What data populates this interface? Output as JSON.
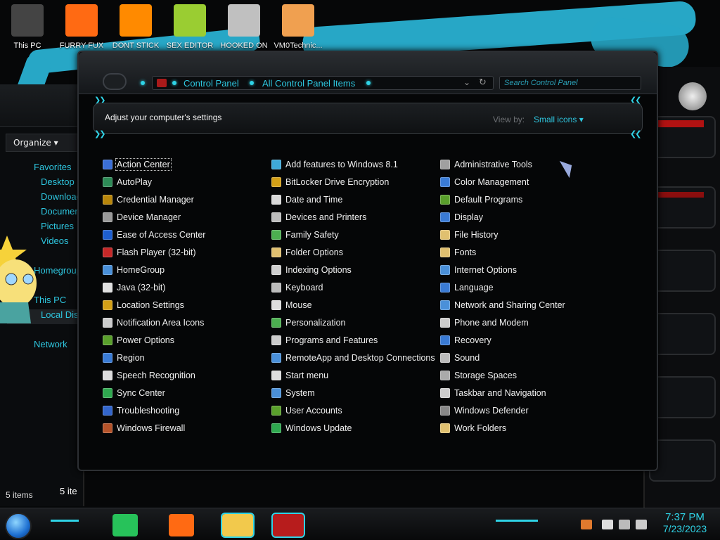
{
  "desktop": {
    "icons": [
      {
        "label": "This PC",
        "icon": "computer-icon",
        "color": "#444444"
      },
      {
        "label": "FURRY FUX",
        "icon": "firefox-icon",
        "color": "#ff6a13"
      },
      {
        "label": "DONT STICK",
        "icon": "vlc-cone-icon",
        "color": "#ff8a00"
      },
      {
        "label": "SEX EDITOR",
        "icon": "hxd-editor-icon",
        "color": "#9acd32"
      },
      {
        "label": "HOOKED ON",
        "icon": "game-icon",
        "color": "#c0c0c0"
      },
      {
        "label": "VM0Technic...",
        "icon": "doctor-avatar-icon",
        "color": "#f0a050"
      }
    ]
  },
  "background_window": {
    "organize": "Organize",
    "nav": [
      "Favorites",
      "Desktop",
      "Downloac",
      "Documen",
      "Pictures",
      "Videos",
      "",
      "Homegroup",
      "",
      "This PC",
      "Local Dis",
      "",
      "Network"
    ],
    "count": "5 ite",
    "status": "5 items"
  },
  "window": {
    "breadcrumb": [
      "Control Panel",
      "All Control Panel Items"
    ],
    "search_placeholder": "Search Control Panel",
    "header_title": "Adjust your computer's settings",
    "view_by_label": "View by:",
    "view_by_value": "Small icons"
  },
  "columns": [
    [
      {
        "label": "Action Center",
        "icon": "flag-icon",
        "color": "#3b6fd8",
        "focused": true
      },
      {
        "label": "AutoPlay",
        "icon": "autoplay-icon",
        "color": "#2e8b57"
      },
      {
        "label": "Credential Manager",
        "icon": "vault-icon",
        "color": "#b8860b"
      },
      {
        "label": "Device Manager",
        "icon": "printer-device-icon",
        "color": "#999999"
      },
      {
        "label": "Ease of Access Center",
        "icon": "accessibility-icon",
        "color": "#1e5fd0"
      },
      {
        "label": "Flash Player (32-bit)",
        "icon": "flash-icon",
        "color": "#c62828"
      },
      {
        "label": "HomeGroup",
        "icon": "homegroup-icon",
        "color": "#4a90d9"
      },
      {
        "label": "Java (32-bit)",
        "icon": "java-icon",
        "color": "#e0e0e0"
      },
      {
        "label": "Location Settings",
        "icon": "location-icon",
        "color": "#d4a017"
      },
      {
        "label": "Notification Area Icons",
        "icon": "notification-icon",
        "color": "#cccccc"
      },
      {
        "label": "Power Options",
        "icon": "power-icon",
        "color": "#5aa02c"
      },
      {
        "label": "Region",
        "icon": "globe-icon",
        "color": "#3a7bd5"
      },
      {
        "label": "Speech Recognition",
        "icon": "microphone-icon",
        "color": "#dddddd"
      },
      {
        "label": "Sync Center",
        "icon": "sync-icon",
        "color": "#2fa84f"
      },
      {
        "label": "Troubleshooting",
        "icon": "troubleshoot-icon",
        "color": "#3366cc"
      },
      {
        "label": "Windows Firewall",
        "icon": "firewall-icon",
        "color": "#b5532a"
      }
    ],
    [
      {
        "label": "Add features to Windows 8.1",
        "icon": "add-features-icon",
        "color": "#3fa9d8"
      },
      {
        "label": "BitLocker Drive Encryption",
        "icon": "bitlocker-icon",
        "color": "#d4a017"
      },
      {
        "label": "Date and Time",
        "icon": "calendar-clock-icon",
        "color": "#d9d9d9"
      },
      {
        "label": "Devices and Printers",
        "icon": "printer-icon",
        "color": "#bdbdbd"
      },
      {
        "label": "Family Safety",
        "icon": "family-icon",
        "color": "#4caf50"
      },
      {
        "label": "Folder Options",
        "icon": "folder-options-icon",
        "color": "#e0c070"
      },
      {
        "label": "Indexing Options",
        "icon": "indexing-icon",
        "color": "#cfcfcf"
      },
      {
        "label": "Keyboard",
        "icon": "keyboard-icon",
        "color": "#bbbbbb"
      },
      {
        "label": "Mouse",
        "icon": "mouse-icon",
        "color": "#dddddd"
      },
      {
        "label": "Personalization",
        "icon": "personalization-icon",
        "color": "#4caf50"
      },
      {
        "label": "Programs and Features",
        "icon": "programs-icon",
        "color": "#cccccc"
      },
      {
        "label": "RemoteApp and Desktop Connections",
        "icon": "remoteapp-icon",
        "color": "#4a90d9"
      },
      {
        "label": "Start menu",
        "icon": "start-menu-icon",
        "color": "#dddddd"
      },
      {
        "label": "System",
        "icon": "system-icon",
        "color": "#4a90d9"
      },
      {
        "label": "User Accounts",
        "icon": "user-accounts-icon",
        "color": "#5aa02c"
      },
      {
        "label": "Windows Update",
        "icon": "windows-update-icon",
        "color": "#2fa84f"
      }
    ],
    [
      {
        "label": "Administrative Tools",
        "icon": "admin-tools-icon",
        "color": "#a0a0a0"
      },
      {
        "label": "Color Management",
        "icon": "color-management-icon",
        "color": "#3a7bd5"
      },
      {
        "label": "Default Programs",
        "icon": "default-programs-icon",
        "color": "#5aa02c"
      },
      {
        "label": "Display",
        "icon": "display-icon",
        "color": "#3a7bd5"
      },
      {
        "label": "File History",
        "icon": "file-history-icon",
        "color": "#e0c070"
      },
      {
        "label": "Fonts",
        "icon": "fonts-icon",
        "color": "#e0c070"
      },
      {
        "label": "Internet Options",
        "icon": "internet-options-icon",
        "color": "#4a90d9"
      },
      {
        "label": "Language",
        "icon": "language-icon",
        "color": "#3a7bd5"
      },
      {
        "label": "Network and Sharing Center",
        "icon": "network-icon",
        "color": "#4a90d9"
      },
      {
        "label": "Phone and Modem",
        "icon": "phone-modem-icon",
        "color": "#cccccc"
      },
      {
        "label": "Recovery",
        "icon": "recovery-icon",
        "color": "#3a7bd5"
      },
      {
        "label": "Sound",
        "icon": "sound-icon",
        "color": "#bbbbbb"
      },
      {
        "label": "Storage Spaces",
        "icon": "storage-icon",
        "color": "#aaaaaa"
      },
      {
        "label": "Taskbar and Navigation",
        "icon": "taskbar-icon",
        "color": "#cccccc"
      },
      {
        "label": "Windows Defender",
        "icon": "defender-icon",
        "color": "#888888"
      },
      {
        "label": "Work Folders",
        "icon": "work-folders-icon",
        "color": "#e0c070"
      }
    ]
  ],
  "taskbar": {
    "apps": [
      {
        "icon": "notes-app-icon",
        "color": "#27c25a"
      },
      {
        "icon": "firefox-icon",
        "color": "#ff6a13"
      },
      {
        "icon": "file-explorer-icon",
        "color": "#f2c94c"
      },
      {
        "icon": "control-panel-icon",
        "color": "#b71c1c"
      }
    ],
    "time": "7:37 PM",
    "date": "7/23/2023"
  },
  "accent": "#2fd3e6"
}
